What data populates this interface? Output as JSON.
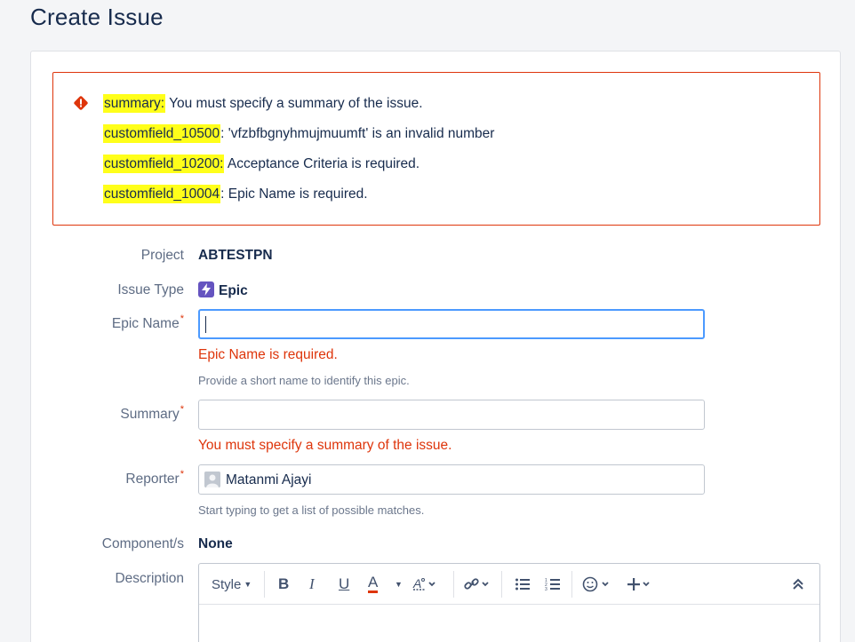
{
  "page": {
    "title": "Create Issue"
  },
  "errors": [
    {
      "field": "summary:",
      "message": " You must specify a summary of the issue."
    },
    {
      "field": "customfield_10500",
      "message": ": 'vfzbfbgnyhmujmuumft' is an invalid number"
    },
    {
      "field": "customfield_10200:",
      "message": " Acceptance Criteria is required."
    },
    {
      "field": "customfield_10004",
      "message": ": Epic Name is required."
    }
  ],
  "form": {
    "project": {
      "label": "Project",
      "value": "ABTESTPN"
    },
    "issue_type": {
      "label": "Issue Type",
      "value": "Epic",
      "icon": "epic-lightning-icon",
      "color": "#6554c0"
    },
    "epic_name": {
      "label": "Epic Name",
      "required_mark": "*",
      "value": "",
      "error": "Epic Name is required.",
      "help": "Provide a short name to identify this epic."
    },
    "summary": {
      "label": "Summary",
      "required_mark": "*",
      "value": "",
      "error": "You must specify a summary of the issue."
    },
    "reporter": {
      "label": "Reporter",
      "required_mark": "*",
      "value": "Matanmi Ajayi",
      "help": "Start typing to get a list of possible matches."
    },
    "components": {
      "label": "Component/s",
      "value": "None"
    },
    "description": {
      "label": "Description",
      "toolbar": {
        "style_label": "Style",
        "bold": "B",
        "italic": "I",
        "underline": "U",
        "text_color": "A"
      }
    }
  },
  "colors": {
    "error": "#de350b",
    "highlight": "#ffff1a",
    "focus": "#4c9aff",
    "text": "#172b4d",
    "label": "#5e6c84"
  }
}
